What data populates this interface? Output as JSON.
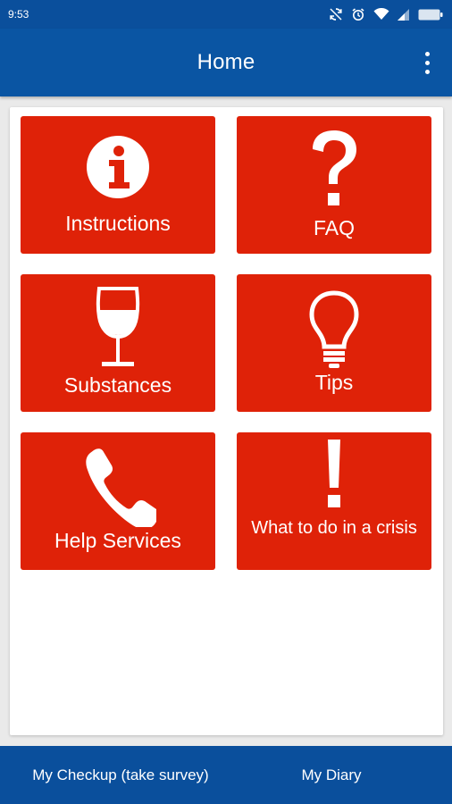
{
  "status_bar": {
    "time": "9:53",
    "icons": [
      "sync-icon",
      "alarm-icon",
      "wifi-icon",
      "signal-icon",
      "battery-icon"
    ]
  },
  "app_bar": {
    "title": "Home",
    "menu_icon": "overflow-menu-icon"
  },
  "tiles": [
    {
      "label": "Instructions",
      "icon": "info-icon"
    },
    {
      "label": "FAQ",
      "icon": "question-mark-icon"
    },
    {
      "label": "Substances",
      "icon": "wine-glass-icon"
    },
    {
      "label": "Tips",
      "icon": "lightbulb-icon"
    },
    {
      "label": "Help Services",
      "icon": "phone-icon"
    },
    {
      "label": "What to do in a crisis",
      "icon": "exclamation-icon"
    }
  ],
  "bottom_nav": {
    "checkup_label": "My Checkup (take survey)",
    "diary_label": "My Diary"
  },
  "colors": {
    "primary_blue": "#0a55a3",
    "tile_red": "#df2208",
    "card_bg": "#ffffff"
  }
}
